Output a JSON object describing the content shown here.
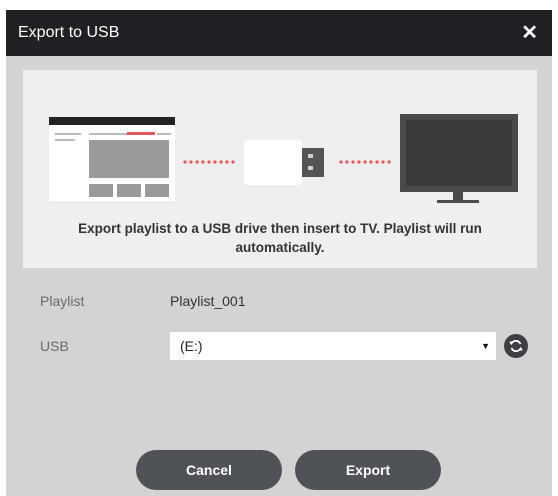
{
  "dialog": {
    "title": "Export to USB",
    "close_icon": "close-icon",
    "illustration": {
      "left_icon": "playlist-screen-icon",
      "middle_icon": "usb-drive-icon",
      "right_icon": "tv-monitor-icon",
      "dot_color": "#e8545c"
    },
    "info_text": "Export playlist to a USB drive then insert to TV. Playlist will run automatically.",
    "playlist": {
      "label": "Playlist",
      "value": "Playlist_001"
    },
    "usb": {
      "label": "USB",
      "selected": "(E:)",
      "refresh_icon": "refresh-icon"
    },
    "buttons": {
      "cancel": "Cancel",
      "export": "Export"
    }
  }
}
